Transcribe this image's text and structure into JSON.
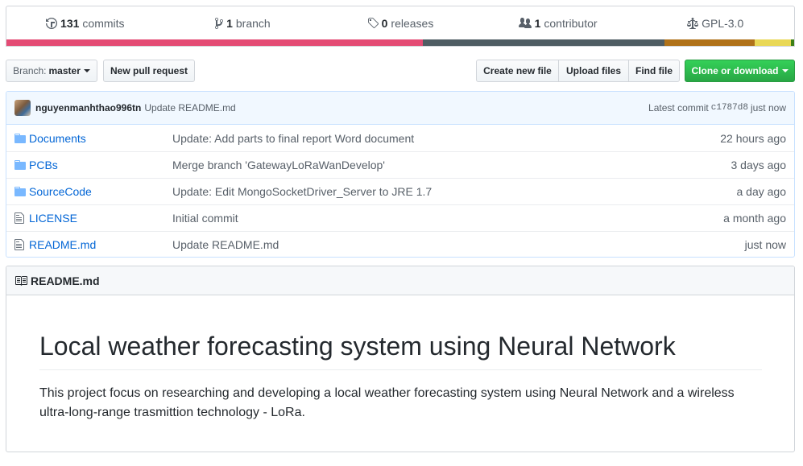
{
  "summary": {
    "commits_count": "131",
    "commits_label": "commits",
    "branch_count": "1",
    "branch_label": "branch",
    "releases_count": "0",
    "releases_label": "releases",
    "contributors_count": "1",
    "contributors_label": "contributor",
    "license": "GPL-3.0",
    "language_colors": [
      "#e44b74",
      "#4f5d63",
      "#b07219",
      "#e9d856",
      "#3c7f15"
    ]
  },
  "toolbar": {
    "branch_prefix": "Branch:",
    "branch_name": "master",
    "new_pull_request": "New pull request",
    "create_new_file": "Create new file",
    "upload_files": "Upload files",
    "find_file": "Find file",
    "clone_or_download": "Clone or download"
  },
  "latest_commit": {
    "author": "nguyenmanhthao996tn",
    "message": "Update README.md",
    "label": "Latest commit",
    "sha": "c1787d8",
    "time": "just now"
  },
  "files": [
    {
      "name": "Documents",
      "type": "folder",
      "message": "Update: Add parts to final report Word document",
      "age": "22 hours ago"
    },
    {
      "name": "PCBs",
      "type": "folder",
      "message": "Merge branch 'GatewayLoRaWanDevelop'",
      "age": "3 days ago"
    },
    {
      "name": "SourceCode",
      "type": "folder",
      "message": "Update: Edit MongoSocketDriver_Server to JRE 1.7",
      "age": "a day ago"
    },
    {
      "name": "LICENSE",
      "type": "file",
      "message": "Initial commit",
      "age": "a month ago"
    },
    {
      "name": "README.md",
      "type": "file",
      "message": "Update README.md",
      "age": "just now"
    }
  ],
  "readme": {
    "filename": "README.md",
    "title": "Local weather forecasting system using Neural Network",
    "text": "This project focus on researching and developing a local weather forecasting system using Neural Network and a wireless ultra-long-range trasmittion technology - LoRa."
  }
}
